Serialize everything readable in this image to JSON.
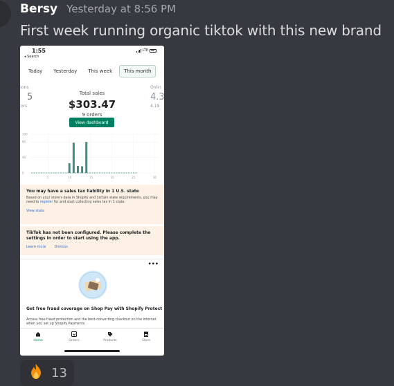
{
  "message": {
    "username": "Bersy",
    "timestamp": "Yesterday at 8:56 PM",
    "text": "First week running organic tiktok with this new brand"
  },
  "screenshot": {
    "status_bar": {
      "time": "1:55",
      "back": "◂ Search",
      "network": "LTE"
    },
    "tabs": [
      "Today",
      "Yesterday",
      "This week",
      "This month"
    ],
    "active_tab": "This month",
    "metrics": {
      "left": {
        "label": "sions",
        "value": "5",
        "sub": "itors"
      },
      "center": {
        "label": "Total sales",
        "value": "$303.47",
        "sub": "9 orders"
      },
      "right": {
        "label": "Onlin",
        "value": "4.3",
        "sub": "4.19"
      }
    },
    "dashboard_button": "View dashboard",
    "chart_data": {
      "type": "bar",
      "y_ticks": [
        "100",
        "80",
        "40",
        "0"
      ],
      "x_ticks": [
        "5",
        "10",
        "15",
        "20",
        "25",
        "30"
      ],
      "ylim": [
        0,
        100
      ],
      "bars": [
        {
          "day": 10,
          "value": 25
        },
        {
          "day": 11,
          "value": 78
        },
        {
          "day": 12,
          "value": 18
        },
        {
          "day": 13,
          "value": 17
        },
        {
          "day": 14,
          "value": 80
        }
      ]
    },
    "tax_banner": {
      "title": "You may have a sales tax liability in 1 U.S. state",
      "text_before": "Based on your store's data in Shopify and certain state requirements, you may need to ",
      "text_link": "register",
      "text_after": " for and start collecting sales tax in 1 state.",
      "action": "View state"
    },
    "tiktok_banner": {
      "title": "TikTok has not been configured. Please complete the settings in order to start using the app.",
      "learn_more": "Learn more",
      "dismiss": "Dismiss"
    },
    "card": {
      "more": "•••",
      "title": "Get free fraud coverage on Shop Pay with Shopify Protect",
      "text": "Access free fraud protection and the best-converting checkout on the internet when you set up Shopify Payments"
    },
    "bottom_nav": [
      "Home",
      "Orders",
      "Products",
      "Store"
    ]
  },
  "reaction": {
    "emoji": "🔥",
    "count": "13"
  }
}
